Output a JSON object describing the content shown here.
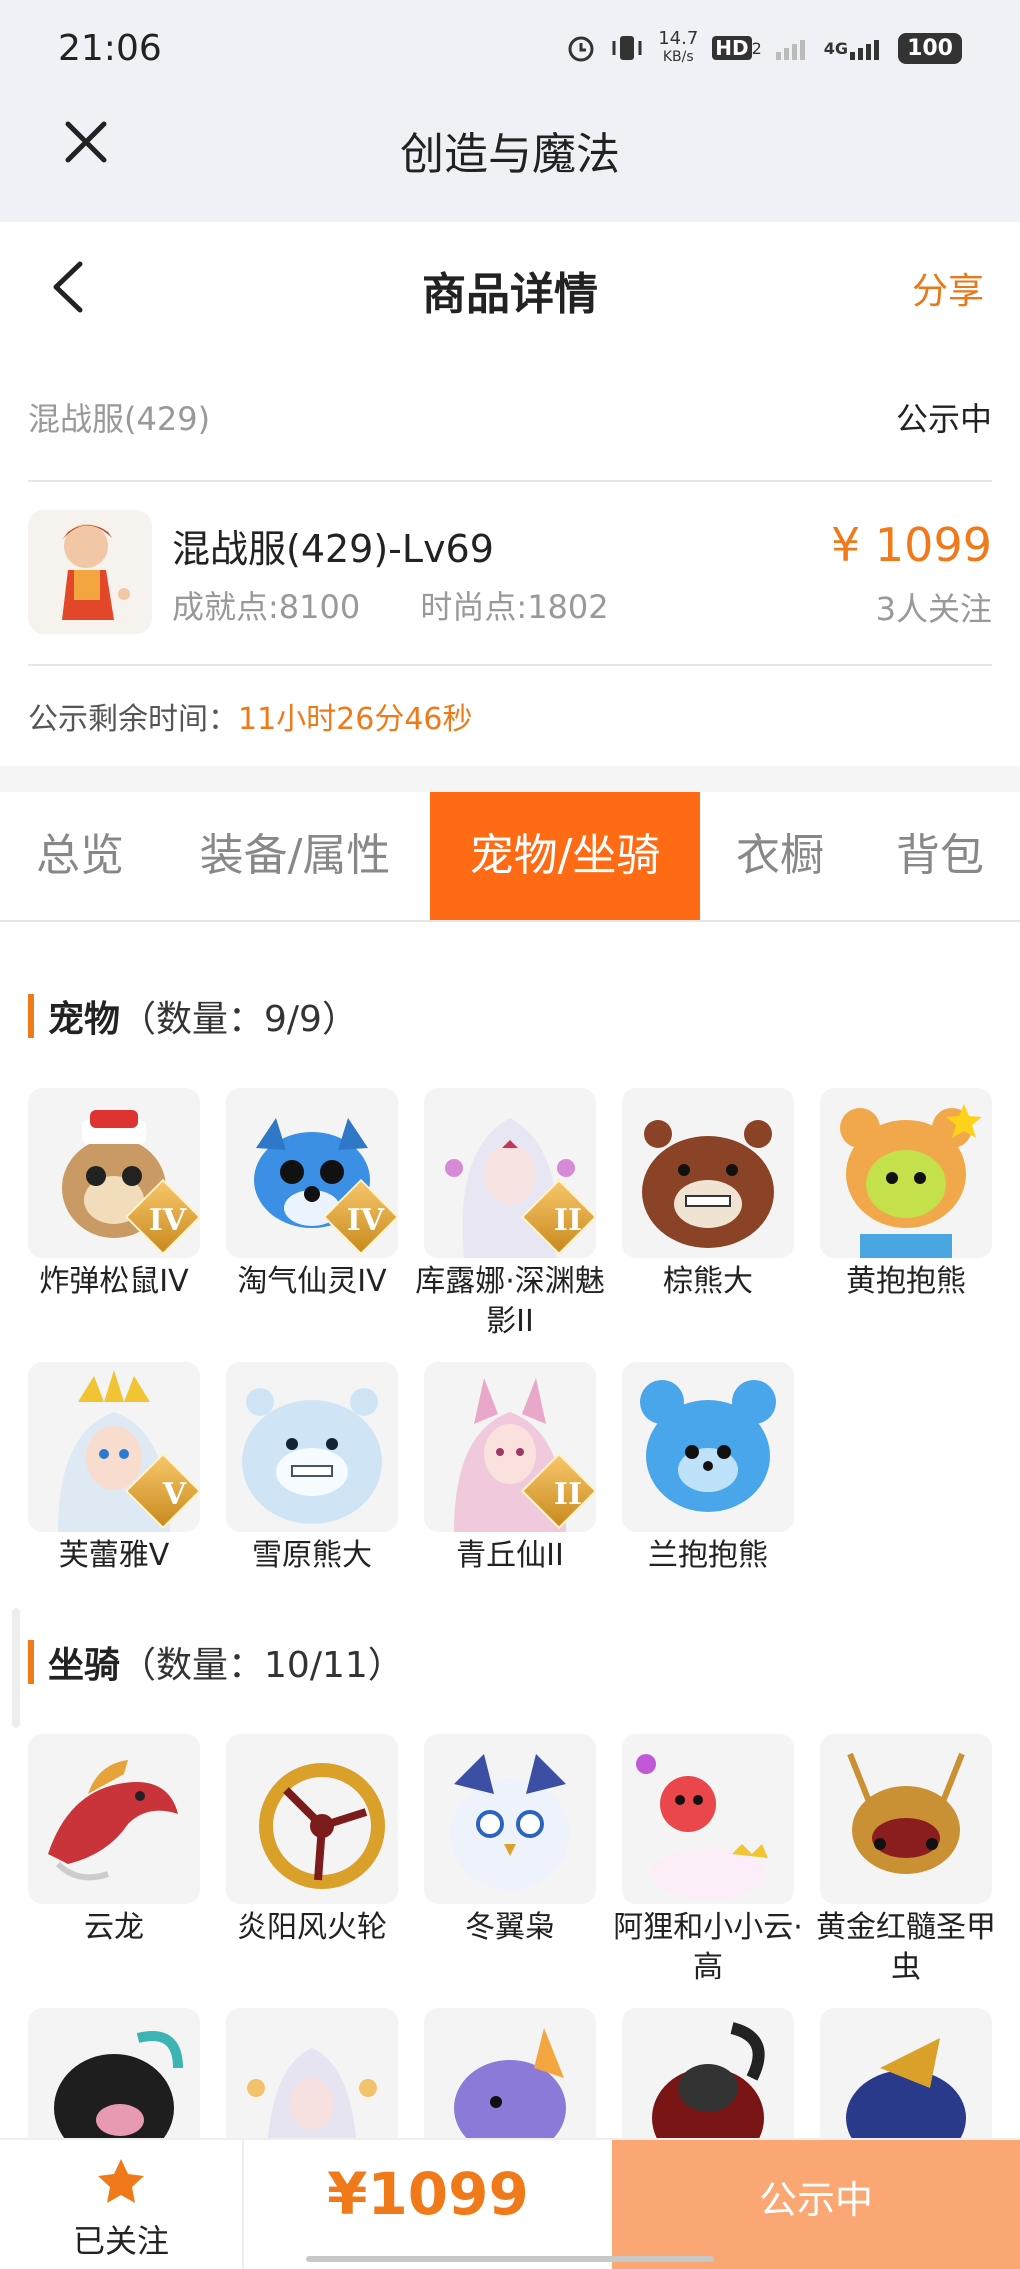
{
  "status_bar": {
    "time": "21:06",
    "speed": "14.7",
    "speed_unit": "KB/s",
    "hd": "HD",
    "hd_sub": "2",
    "net": "4G",
    "battery": "100"
  },
  "app": {
    "title": "创造与魔法"
  },
  "nav": {
    "title": "商品详情",
    "share": "分享"
  },
  "listing": {
    "server": "混战服(429)",
    "status": "公示中",
    "char_name": "混战服(429)-Lv69",
    "achievement": "成就点:8100",
    "fashion": "时尚点:1802",
    "price": "¥ 1099",
    "followers": "3人关注",
    "timer_label": "公示剩余时间：",
    "timer_value": "11小时26分46秒"
  },
  "tabs": [
    "总览",
    "装备/属性",
    "宠物/坐骑",
    "衣橱",
    "背包"
  ],
  "active_tab": 2,
  "pets": {
    "title": "宠物",
    "count": "（数量：9/9）",
    "items": [
      "炸弹松鼠IV",
      "淘气仙灵IV",
      "库露娜·深渊魅影II",
      "棕熊大",
      "黄抱抱熊",
      "芙蕾雅V",
      "雪原熊大",
      "青丘仙II",
      "兰抱抱熊"
    ]
  },
  "mounts": {
    "title": "坐骑",
    "count": "（数量：10/11）",
    "items": [
      "云龙",
      "炎阳风火轮",
      "冬翼枭",
      "阿狸和小小云·高",
      "黄金红髓圣甲虫"
    ]
  },
  "tier_marks": {
    "p0": "IV",
    "p1": "IV",
    "p2": "II",
    "p5": "V",
    "p7": "II"
  },
  "bottom": {
    "follow": "已关注",
    "price": "¥1099",
    "status": "公示中"
  },
  "colors": {
    "accent": "#f07a1a",
    "tab_active": "#ff6a14",
    "status_button": "#fba774"
  }
}
